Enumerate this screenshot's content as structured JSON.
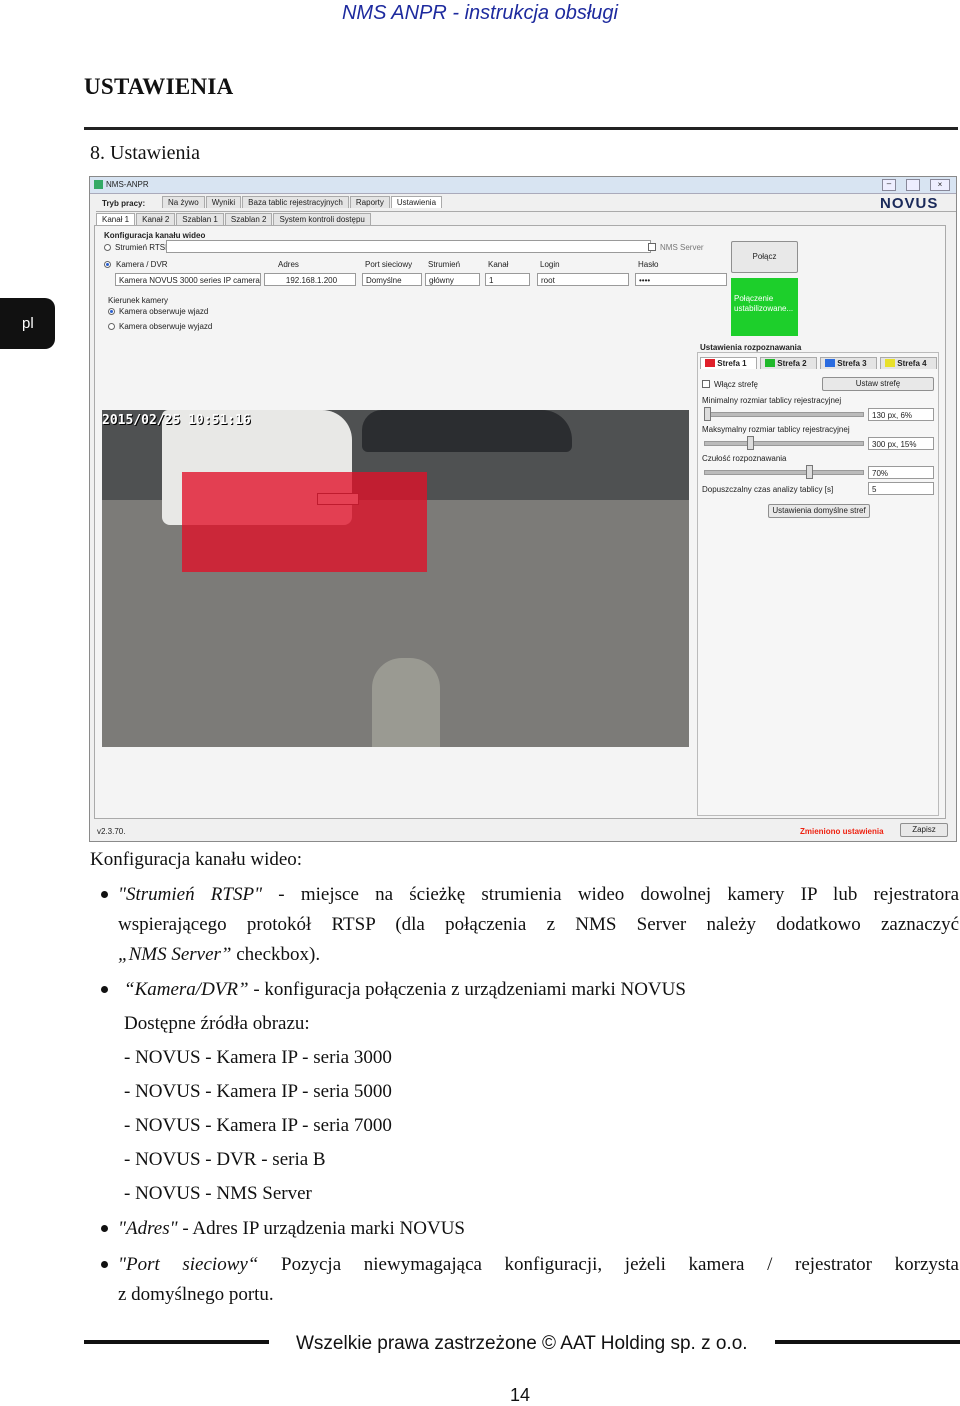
{
  "header": {
    "title": "NMS ANPR - instrukcja obsługi"
  },
  "side_tab": "pl",
  "section": {
    "heading": "USTAWIENIA",
    "subheading": "8. Ustawienia"
  },
  "app": {
    "window_title": "NMS-ANPR",
    "mode_label": "Tryb pracy:",
    "main_tabs": [
      "Na żywo",
      "Wyniki",
      "Baza tablic rejestracyjnych",
      "Raporty",
      "Ustawienia"
    ],
    "channel_tabs": [
      "Kanał 1",
      "Kanał 2",
      "Szablan 1",
      "Szablan 2",
      "System kontroli dostępu"
    ],
    "logo": "NOVUS",
    "video_config_title": "Konfiguracja kanału wideo",
    "rtsp_label": "Strumień RTSP",
    "camera_label": "Kamera / DVR",
    "camera_value": "Kamera NOVUS 3000 series IP camera",
    "address_label": "Adres",
    "address_value": "192.168.1.200",
    "port_label": "Port sieciowy",
    "port_value": "Domyślne",
    "stream_label": "Strumień",
    "stream_value": "główny",
    "channel_label": "Kanał",
    "channel_value": "1",
    "login_label": "Login",
    "login_value": "root",
    "nms_server_label": "NMS Server",
    "password_label": "Hasło",
    "password_value": "••••",
    "connect_button": "Połącz",
    "status_text": "Połączenie ustabilizowane...",
    "direction_label": "Kierunek kamery",
    "dir_in": "Kamera obserwuje wjazd",
    "dir_out": "Kamera obserwuje wyjazd",
    "recog_title": "Ustawienia rozpoznawania",
    "zones": [
      "Strefa 1",
      "Strefa 2",
      "Strefa 3",
      "Strefa 4"
    ],
    "zone_colors": [
      "#e0202a",
      "#1fb82a",
      "#2a6be0",
      "#e8e02a"
    ],
    "enable_zone": "Włącz strefę",
    "set_zone": "Ustaw strefę",
    "min_plate_label": "Minimalny rozmiar tablicy rejestracyjnej",
    "min_plate_value": "130 px, 6%",
    "max_plate_label": "Maksymalny rozmiar tablicy rejestracyjnej",
    "max_plate_value": "300 px, 15%",
    "sens_label": "Czułość rozpoznawania",
    "sens_value": "70%",
    "time_label": "Dopuszczalny czas analizy tablicy [s]",
    "time_value": "5",
    "default_zone_btn": "Ustawienia domyślne stref",
    "timestamp": "2015/02/25 10:51:16",
    "version": "v2.3.70.",
    "changed_text": "Zmieniono ustawienia",
    "save_button": "Zapisz"
  },
  "body": {
    "intro": "Konfiguracja kanału wideo:",
    "b1_title": "\"Strumień RTSP\"",
    "b1_text1": " - miejsce na ścieżkę strumienia wideo dowolnej kamery IP lub rejestratora",
    "b1_text2": "wspierającego protokół RTSP   (dla połączenia z NMS Server należy dodatkowo zaznaczyć",
    "b1_text3_it": "„NMS Server”",
    "b1_text3": " checkbox).",
    "b2_title": "“Kamera/DVR”",
    "b2_text": " - konfiguracja połączenia z urządzeniami marki NOVUS",
    "sources_title": "Dostępne źródła obrazu:",
    "sources": [
      "- NOVUS - Kamera IP - seria 3000",
      "- NOVUS - Kamera IP - seria 5000",
      "- NOVUS - Kamera IP - seria 7000",
      "- NOVUS - DVR - seria B",
      "- NOVUS - NMS Server"
    ],
    "b3_title": "\"Adres\"",
    "b3_text": " - Adres IP urządzenia marki NOVUS",
    "b4_title": "\"Port sieciowy“",
    "b4_text1": " Pozycja niewymagająca konfiguracji, jeżeli kamera / rejestrator korzysta",
    "b4_text2": "z domyślnego portu."
  },
  "footer": {
    "copyright": "Wszelkie prawa zastrzeżone © AAT Holding sp. z o.o.",
    "page_number": "14"
  }
}
